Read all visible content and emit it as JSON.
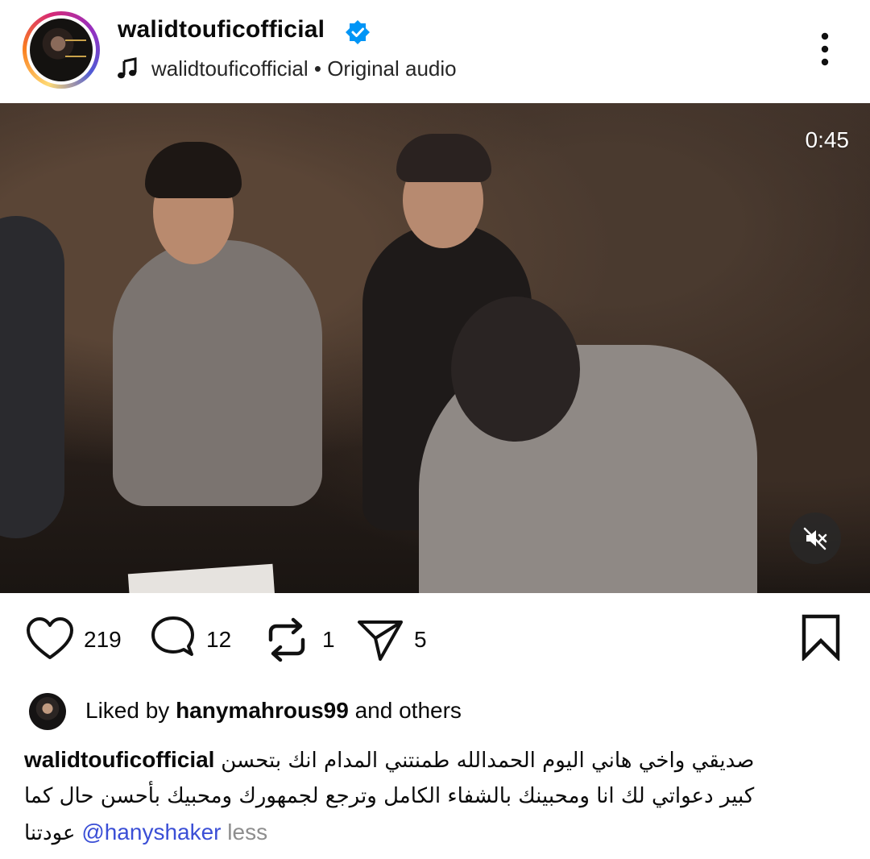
{
  "header": {
    "username": "walidtouficofficial",
    "verified": true,
    "audio_owner": "walidtouficofficial",
    "audio_separator": " • ",
    "audio_label": "Original audio"
  },
  "video": {
    "duration": "0:45",
    "muted": true
  },
  "actions": {
    "likes": "219",
    "comments": "12",
    "reposts": "1",
    "shares": "5"
  },
  "liked_by": {
    "prefix": "Liked by ",
    "user": "hanymahrous99",
    "suffix": " and others"
  },
  "caption": {
    "username": "walidtouficofficial",
    "line1_text": "صديقي واخي هاني اليوم الحمدالله طمنتني المدام انك بتحسن",
    "line2_text": "كبير دعواتي لك انا ومحبينك بالشفاء الكامل وترجع لجمهورك ومحبيك بأحسن حال كما",
    "line3_text": "عودتنا",
    "mention": "@hanyshaker",
    "less_label": "less"
  },
  "colors": {
    "verified_blue": "#0095f6",
    "mention_blue": "#3b4fd6",
    "muted_gray": "#8e8e8e"
  },
  "icons": [
    "music-icon",
    "more-options-icon",
    "mute-icon",
    "heart-icon",
    "comment-icon",
    "repost-icon",
    "share-icon",
    "bookmark-icon",
    "verified-badge-icon"
  ]
}
